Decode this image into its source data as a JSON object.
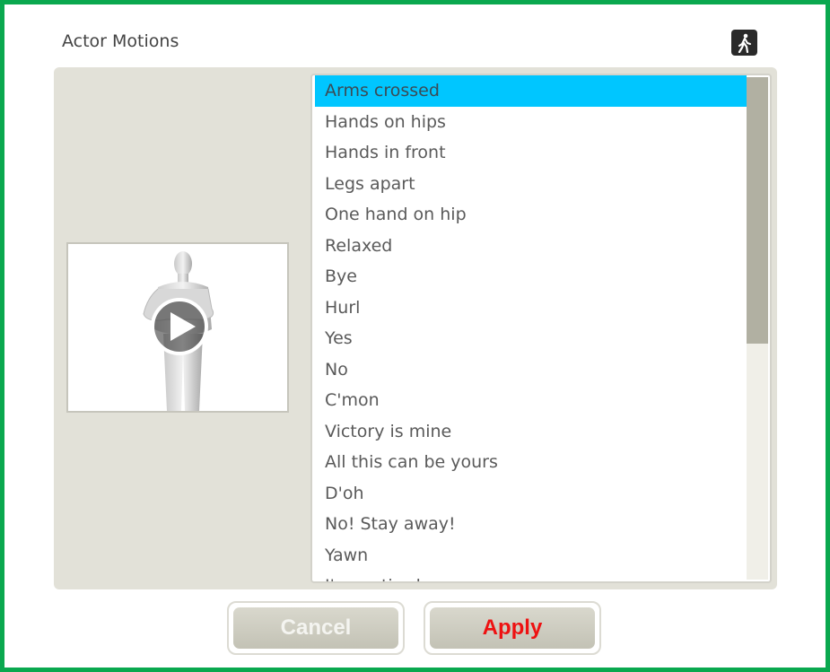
{
  "dialog": {
    "title": "Actor Motions",
    "walk_icon": "walking-person-icon"
  },
  "preview": {
    "figure": "mannequin-figure",
    "play_icon": "play-icon"
  },
  "motions": {
    "selected_index": 0,
    "items": [
      "Arms crossed",
      "Hands on hips",
      "Hands in front",
      "Legs apart",
      "One hand on hip",
      "Relaxed",
      "Bye",
      "Hurl",
      "Yes",
      "No",
      "C'mon",
      "Victory is mine",
      "All this can be yours",
      "D'oh",
      "No! Stay away!",
      "Yawn",
      "I'm so tired"
    ],
    "scroll_position": 0.0,
    "scroll_visible_fraction": 0.53
  },
  "buttons": {
    "cancel_label": "Cancel",
    "apply_label": "Apply"
  },
  "colors": {
    "frame": "#0aa84f",
    "selection": "#00c6ff",
    "apply_text": "#ee1111"
  }
}
